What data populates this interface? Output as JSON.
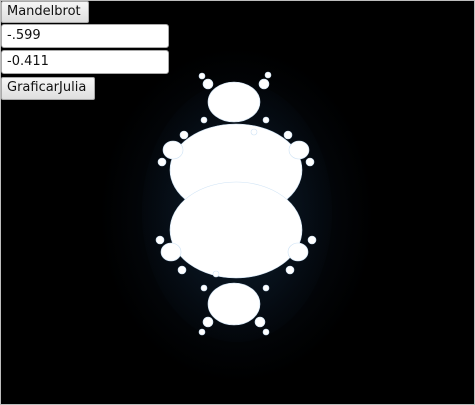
{
  "controls": {
    "mandelbrot_button_label": "Mandelbrot",
    "real_input_value": "-.599",
    "imag_input_value": "-0.411",
    "graph_julia_button_label": "GraficarJulia"
  },
  "render": {
    "background_color": "#000000",
    "set_color": "#ffffff",
    "halo_color": "#0a1a2a"
  }
}
